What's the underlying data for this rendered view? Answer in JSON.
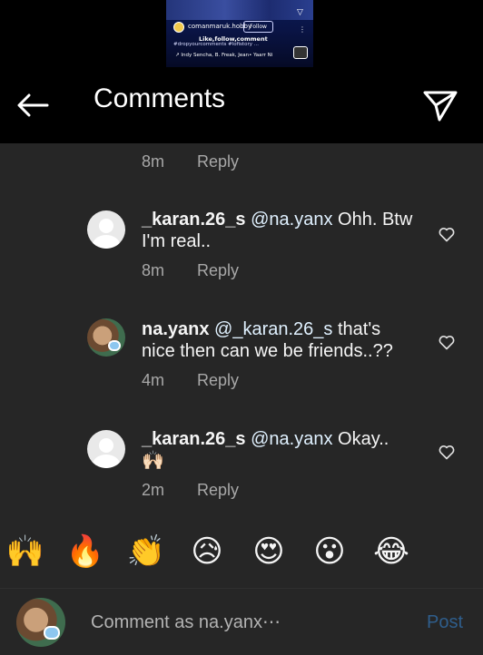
{
  "thumbnail": {
    "username": "comanmaruk.hobby",
    "follow_label": "Follow",
    "caption": "Like,follow,comment",
    "tags": "#dropyourcomments #lofistory ...",
    "music": "↗ Indy Sencha, B. Freak, Jean• Yaarr Ni",
    "menu_dots": "⋮"
  },
  "header": {
    "title": "Comments"
  },
  "comments": [
    {
      "time": "8m",
      "reply_label": "Reply"
    },
    {
      "username": "_karan.26_s",
      "mention": "@na.yanx",
      "text": " Ohh. Btw I'm real..",
      "time": "8m",
      "reply_label": "Reply"
    },
    {
      "username": "na.yanx",
      "mention": "@_karan.26_s",
      "text": " that's nice then can we be friends..??",
      "time": "4m",
      "reply_label": "Reply"
    },
    {
      "username": "_karan.26_s",
      "mention": "@na.yanx",
      "text": " Okay.. 🙌🏻",
      "time": "2m",
      "reply_label": "Reply"
    }
  ],
  "emoji_bar": [
    "🙌",
    "🔥",
    "👏",
    "😥",
    "😍",
    "😮",
    "😂"
  ],
  "composer": {
    "placeholder": "Comment as na.yanx⋯",
    "post_label": "Post"
  },
  "colors": {
    "background": "#262626",
    "top_bar": "#000000",
    "secondary_text": "#a8a8a8",
    "post_disabled": "#2f5e8c"
  }
}
